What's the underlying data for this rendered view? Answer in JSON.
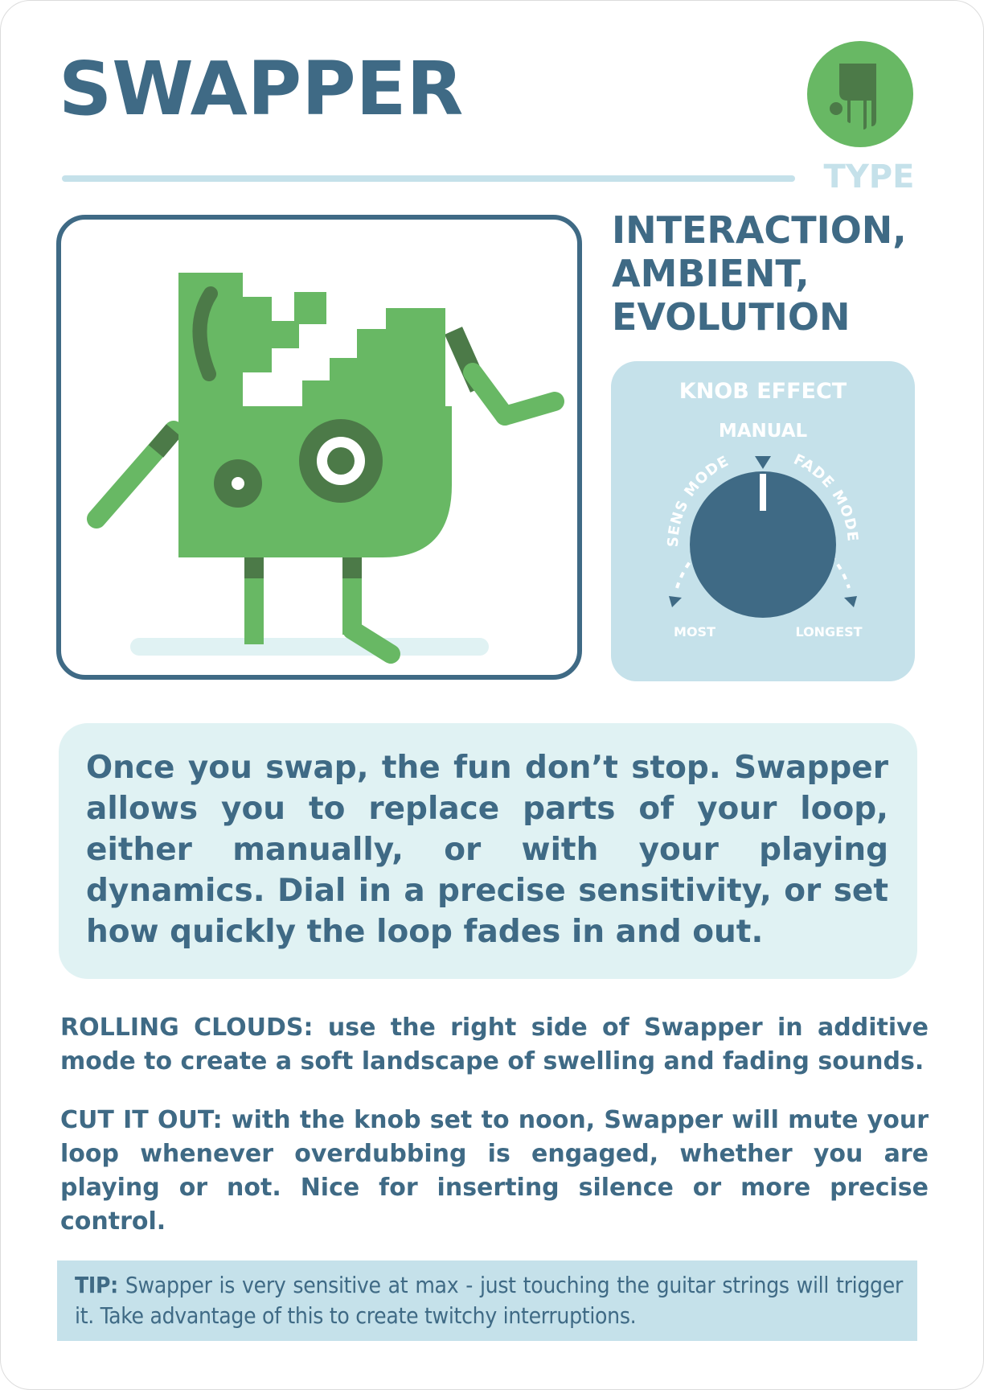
{
  "card": {
    "title": "SWAPPER",
    "type_label": "TYPE",
    "type_icon": "hand-icon",
    "types": [
      "INTERACTION,",
      "AMBIENT,",
      "EVOLUTION"
    ]
  },
  "knob": {
    "title": "KNOB EFFECT",
    "top_label": "MANUAL",
    "left_arc_label": "SENS MODE",
    "right_arc_label": "FADE MODE",
    "left_end_label": "MOST",
    "right_end_label": "LONGEST"
  },
  "description": "Once you swap, the fun don’t stop. Swapper allows you to replace parts of your loop, either manually, or with your playing dynamics. Dial in a precise sensitivity, or set how quickly the loop fades in and out.",
  "tips": [
    {
      "lead": "ROLLING CLOUDS:",
      "text": " use the right side of Swapper in additive mode to create a soft landscape of swelling and fading sounds."
    },
    {
      "lead": "CUT IT OUT:",
      "text": " with the knob set to noon, Swapper will mute your loop whenever overdubbing is engaged, whether you are playing or not. Nice for inserting silence or more precise control."
    }
  ],
  "tip": {
    "lead": "TIP:",
    "text": " Swapper is very sensitive at max - just touching the guitar strings will trigger it. Take advantage of this to create twitchy interruptions."
  },
  "colors": {
    "primary": "#3f6a85",
    "light_blue": "#c5e1ea",
    "pale_teal": "#e0f2f3",
    "green": "#68b864",
    "dark_green": "#4c7a48"
  }
}
